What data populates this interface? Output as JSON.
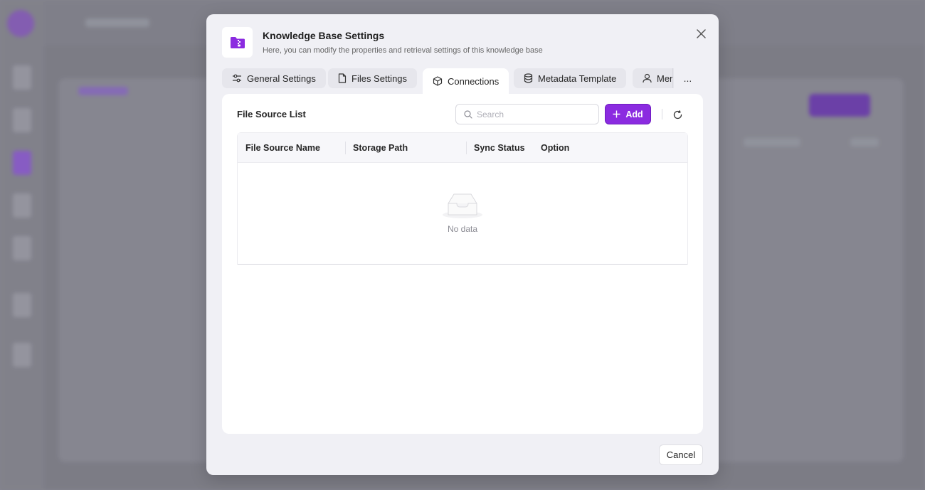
{
  "modal": {
    "title": "Knowledge Base Settings",
    "description": "Here, you can modify the properties and retrieval settings of this knowledge base",
    "icon": "folder-zip-icon",
    "close_icon": "close-icon",
    "accent_color": "#8b2be0"
  },
  "tabs": [
    {
      "label": "General Settings",
      "icon": "sliders-icon",
      "active": false
    },
    {
      "label": "Files Settings",
      "icon": "file-icon",
      "active": false
    },
    {
      "label": "Connections",
      "icon": "cube-icon",
      "active": true
    },
    {
      "label": "Metadata Template",
      "icon": "database-icon",
      "active": false
    },
    {
      "label": "Mer",
      "icon": "user-icon",
      "active": false
    }
  ],
  "tabs_more": "...",
  "panel": {
    "title": "File Source List",
    "search_placeholder": "Search",
    "add_label": "Add"
  },
  "table": {
    "columns": [
      "File Source Name",
      "Storage Path",
      "Sync Status",
      "Option"
    ],
    "rows": [],
    "empty_text": "No data"
  },
  "footer": {
    "cancel_label": "Cancel"
  }
}
